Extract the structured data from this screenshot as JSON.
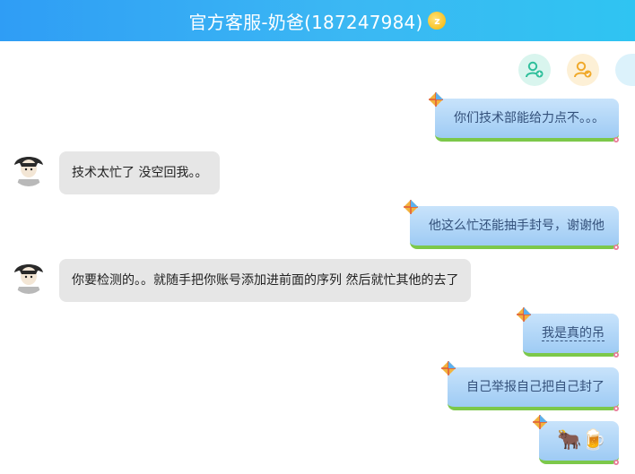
{
  "header": {
    "title": "官方客服-奶爸(187247984)",
    "vip_label": "z"
  },
  "messages": [
    {
      "side": "right",
      "text": "你们技术部能给力点不。。。"
    },
    {
      "side": "left",
      "text": "技术太忙了 没空回我。。"
    },
    {
      "side": "right",
      "text": "他这么忙还能抽手封号，谢谢他"
    },
    {
      "side": "left",
      "text": "你要检测的。。就随手把你账号添加进前面的序列  然后就忙其他的去了"
    },
    {
      "side": "right",
      "text": "我是真的吊"
    },
    {
      "side": "right",
      "text": "自己举报自己把自己封了"
    },
    {
      "side": "right",
      "text": "🐂🍺"
    }
  ],
  "colors": {
    "header_start": "#2f9df5",
    "header_end": "#2fc4f2",
    "bubble_right_top": "#c8e3fb",
    "bubble_right_bottom": "#9ecbf4",
    "bubble_grass": "#7cc84a",
    "bubble_left": "#e6e6e6"
  },
  "icons": [
    "add-friend-icon",
    "group-add-icon",
    "more-icon"
  ]
}
